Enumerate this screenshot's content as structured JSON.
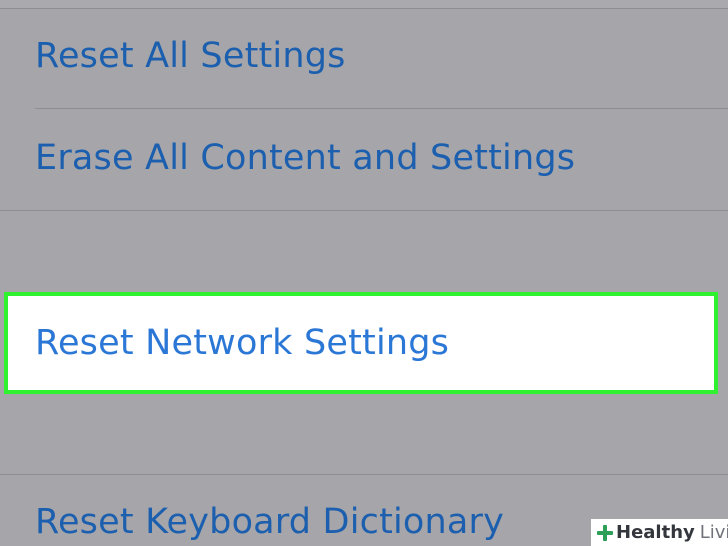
{
  "settings_list": {
    "items": [
      {
        "label": "Reset All Settings"
      },
      {
        "label": "Erase All Content and Settings"
      },
      {
        "label": "Reset Network Settings"
      },
      {
        "label": "Reset Keyboard Dictionary"
      }
    ]
  },
  "watermark": {
    "icon": "plus-icon",
    "brand_primary": "Healthy",
    "brand_secondary": "Living"
  },
  "colors": {
    "list_text": "#1c5fae",
    "highlight_text": "#2b77d6",
    "highlight_border": "#2ff12f",
    "background": "#a6a6aa",
    "watermark_icon": "#2e9f56"
  }
}
